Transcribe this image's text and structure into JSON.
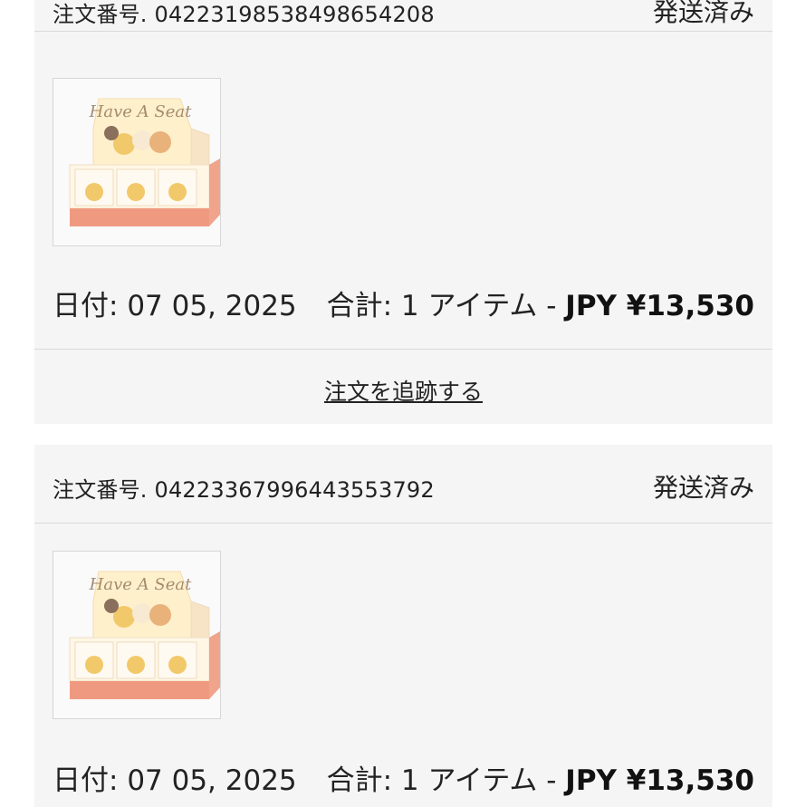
{
  "orders": [
    {
      "order_label": "注文番号.",
      "order_number": "042231985384986542​08",
      "status": "発送済み",
      "product": {
        "image_alt": "Have A Seat blind box display",
        "box_text": "Have A Seat"
      },
      "date_label": "日付:",
      "date": "07 05, 2025",
      "total_label": "合計:",
      "items": "1 アイテム",
      "separator": "-",
      "price": "JPY ¥13,530",
      "track_label": "注文を追跡する"
    },
    {
      "order_label": "注文番号.",
      "order_number": "04223367996443553792",
      "status": "発送済み",
      "product": {
        "image_alt": "Have A Seat blind box display",
        "box_text": "Have A Seat"
      },
      "date_label": "日付:",
      "date": "07 05, 2025",
      "total_label": "合計:",
      "items": "1 アイテム",
      "separator": "-",
      "price": "JPY ¥13,530"
    }
  ],
  "colors": {
    "card_bg": "#f5f5f5",
    "divider": "#d9d9d9",
    "box_salmon": "#ef9a80",
    "box_cream": "#fff3dc",
    "figure_yellow": "#f2c96a"
  }
}
